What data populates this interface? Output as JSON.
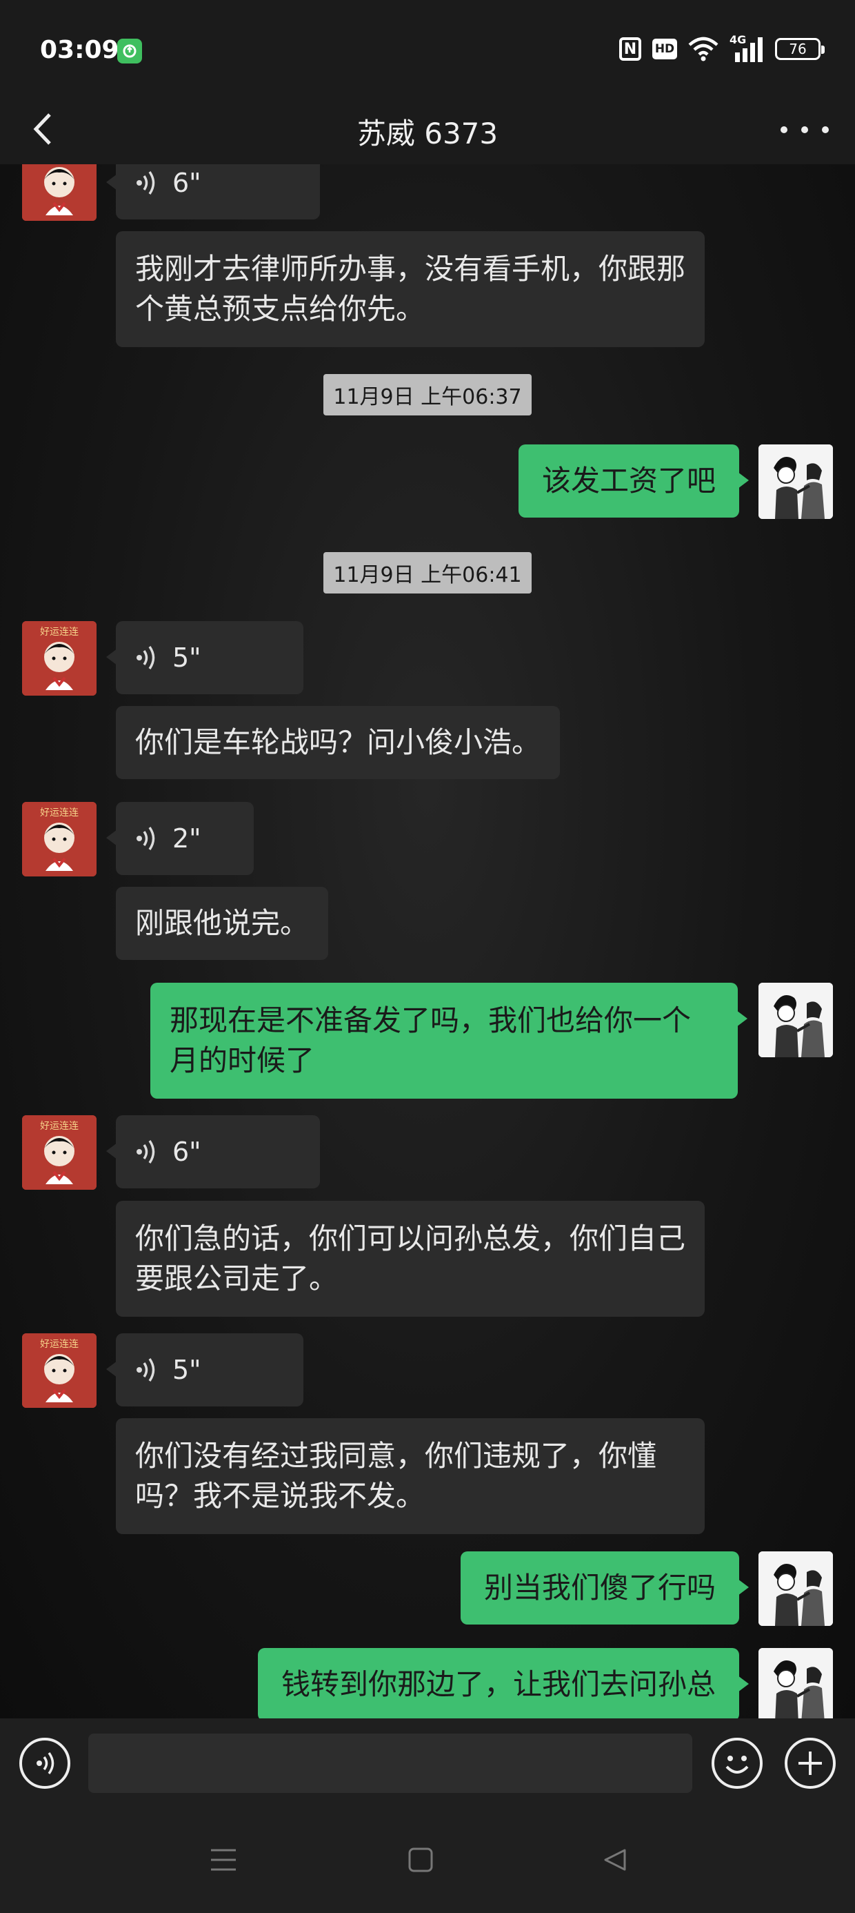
{
  "status_bar": {
    "time": "03:09",
    "icons": [
      "app-notification-icon",
      "nfc-icon",
      "hd-icon",
      "wifi-icon",
      "signal-4g-icon"
    ],
    "hd_label": "HD",
    "nfc_label": "N",
    "network_label": "4G",
    "battery": "76"
  },
  "header": {
    "title": "苏威 6373"
  },
  "messages": [
    {
      "sender": "other",
      "type": "voice",
      "duration": "6\""
    },
    {
      "sender": "other",
      "type": "text",
      "text": "我刚才去律师所办事，没有看手机，你跟那个黄总预支点给你先。"
    },
    {
      "type": "timestamp",
      "text": "11月9日 上午06:37"
    },
    {
      "sender": "me",
      "type": "text",
      "text": "该发工资了吧"
    },
    {
      "type": "timestamp",
      "text": "11月9日 上午06:41"
    },
    {
      "sender": "other",
      "type": "voice",
      "duration": "5\""
    },
    {
      "sender": "other",
      "type": "text",
      "text": "你们是车轮战吗？问小俊小浩。"
    },
    {
      "sender": "other",
      "type": "voice",
      "duration": "2\""
    },
    {
      "sender": "other",
      "type": "text",
      "text": "刚跟他说完。"
    },
    {
      "sender": "me",
      "type": "text",
      "text": "那现在是不准备发了吗，我们也给你一个月的时候了"
    },
    {
      "sender": "other",
      "type": "voice",
      "duration": "6\""
    },
    {
      "sender": "other",
      "type": "text",
      "text": "你们急的话，你们可以问孙总发，你们自己要跟公司走了。"
    },
    {
      "sender": "other",
      "type": "voice",
      "duration": "5\""
    },
    {
      "sender": "other",
      "type": "text",
      "text": "你们没有经过我同意，你们违规了，你懂吗？我不是说我不发。"
    },
    {
      "sender": "me",
      "type": "text",
      "text": "别当我们傻了行吗"
    },
    {
      "sender": "me",
      "type": "text",
      "text": "钱转到你那边了，让我们去问孙总"
    }
  ],
  "avatar": {
    "other_caption": "好运连连"
  },
  "input_bar": {
    "placeholder": ""
  },
  "colors": {
    "my_bubble": "#3ebf70",
    "other_bubble": "#2c2c2c",
    "timestamp_bg": "#bdbdbd"
  }
}
